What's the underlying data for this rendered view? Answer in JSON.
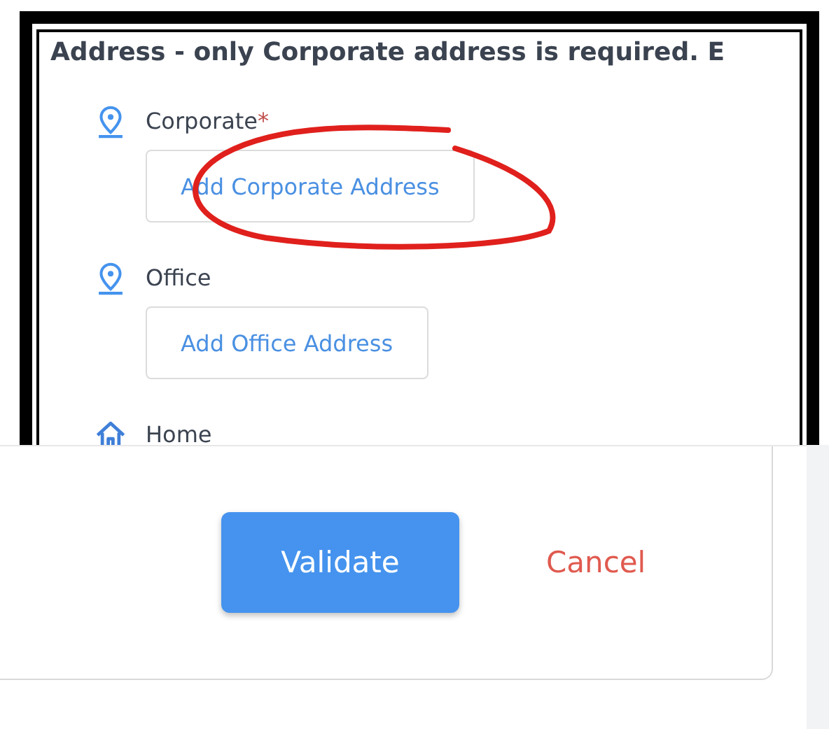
{
  "heading": "Address - only Corporate address is required. E",
  "addresses": [
    {
      "kind": "pin",
      "label": "Corporate",
      "required_mark": "*",
      "button": "Add Corporate Address"
    },
    {
      "kind": "pin",
      "label": "Office",
      "button": "Add Office Address"
    },
    {
      "kind": "house",
      "label": "Home"
    }
  ],
  "actions": [
    {
      "kind": "primary",
      "label": "Validate"
    },
    {
      "kind": "link",
      "label": "Cancel"
    }
  ]
}
